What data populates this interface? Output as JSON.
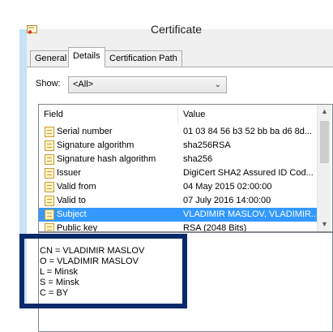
{
  "window": {
    "title": "Certificate"
  },
  "tabs": [
    {
      "label": "General"
    },
    {
      "label": "Details",
      "selected": true
    },
    {
      "label": "Certification Path"
    }
  ],
  "show": {
    "label": "Show:",
    "value": "<All>"
  },
  "list": {
    "columns": [
      "Field",
      "Value"
    ],
    "rows": [
      {
        "field": "Serial number",
        "value": "01 03 84 56 b3 52 bb ba d6 8d..."
      },
      {
        "field": "Signature algorithm",
        "value": "sha256RSA"
      },
      {
        "field": "Signature hash algorithm",
        "value": "sha256"
      },
      {
        "field": "Issuer",
        "value": "DigiCert SHA2 Assured ID Cod..."
      },
      {
        "field": "Valid from",
        "value": "04 May 2015 02:00:00"
      },
      {
        "field": "Valid to",
        "value": "07 July 2016 14:00:00"
      },
      {
        "field": "Subject",
        "value": "VLADIMIR MASLOV, VLADIMIR...",
        "selected": true
      },
      {
        "field": "Public key",
        "value": "RSA (2048 Bits)"
      }
    ]
  },
  "detail": {
    "lines": [
      "CN = VLADIMIR MASLOV",
      "O = VLADIMIR MASLOV",
      "L = Minsk",
      "S = Minsk",
      "C = BY"
    ]
  },
  "colors": {
    "selection": "#3399ff",
    "highlight_box": "#0b2a6b"
  }
}
